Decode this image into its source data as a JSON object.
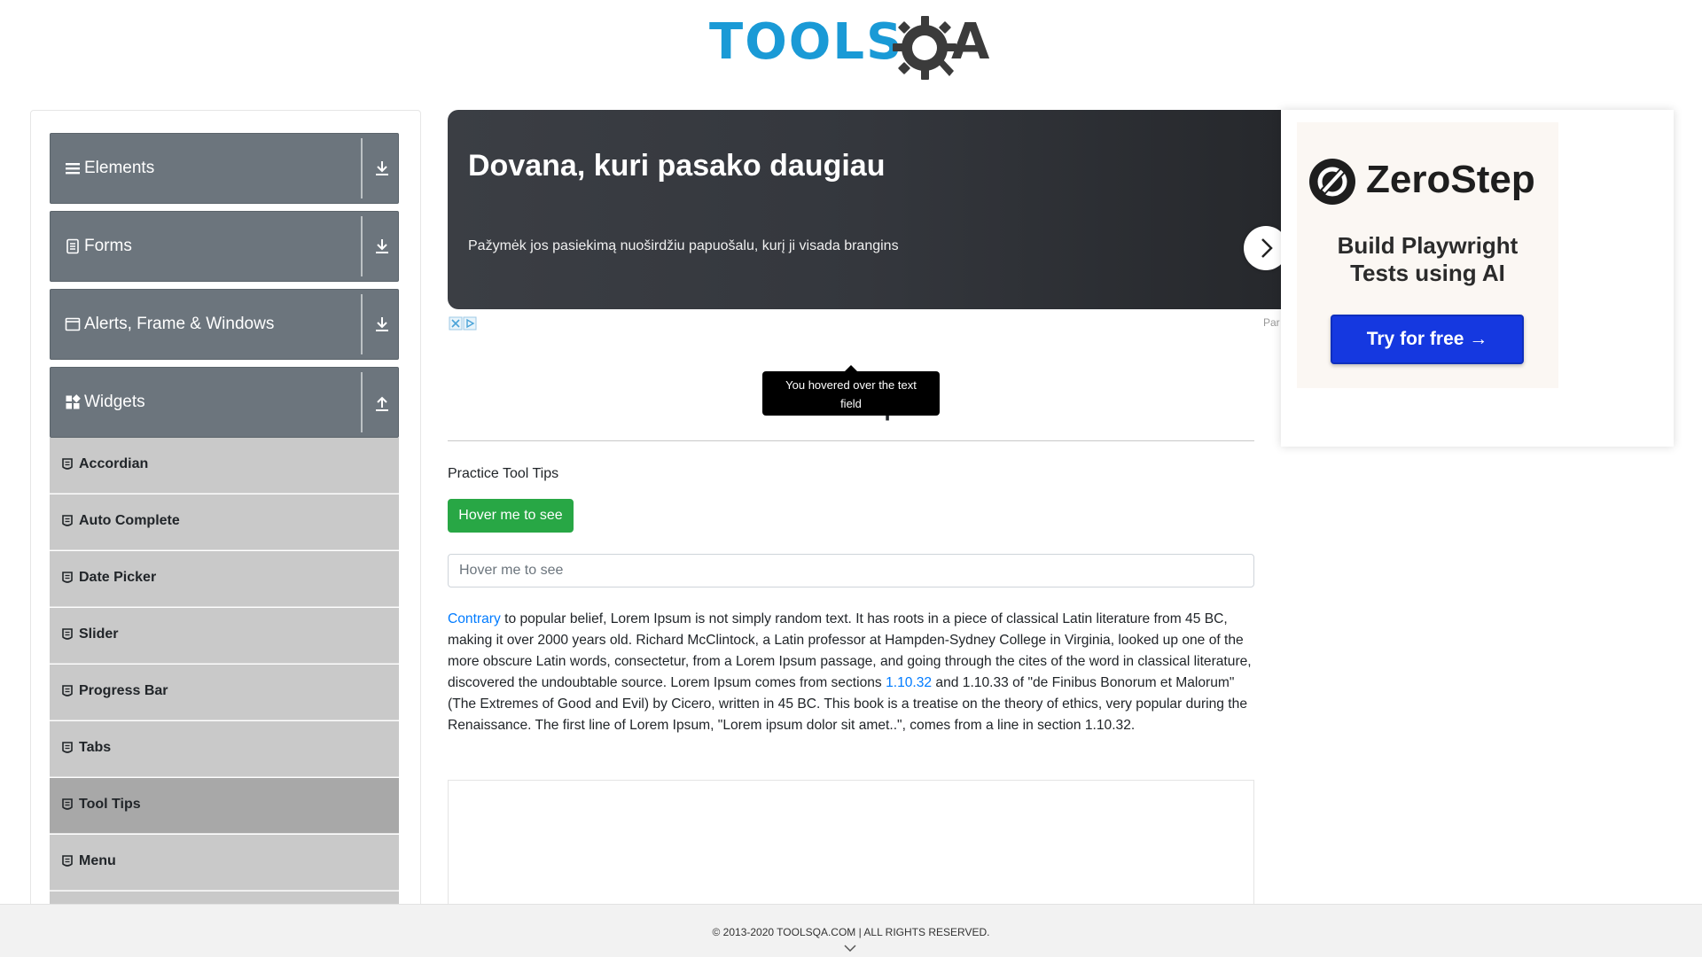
{
  "header": {
    "logo_left": "TOOLS",
    "logo_right": "A",
    "logo_colors": {
      "tools": "#1a9ad6",
      "qa": "#3b3b3b"
    }
  },
  "sidebar": {
    "groups": [
      {
        "label": "Elements",
        "icon": "hamburger-icon",
        "toggle": "download-arrow-icon"
      },
      {
        "label": "Forms",
        "icon": "document-icon",
        "toggle": "download-arrow-icon"
      },
      {
        "label": "Alerts, Frame & Windows",
        "icon": "window-icon",
        "toggle": "download-arrow-icon"
      },
      {
        "label": "Widgets",
        "icon": "widgets-icon",
        "toggle": "upload-arrow-icon"
      }
    ],
    "items": [
      {
        "label": "Accordian",
        "active": false
      },
      {
        "label": "Auto Complete",
        "active": false
      },
      {
        "label": "Date Picker",
        "active": false
      },
      {
        "label": "Slider",
        "active": false
      },
      {
        "label": "Progress Bar",
        "active": false
      },
      {
        "label": "Tabs",
        "active": false
      },
      {
        "label": "Tool Tips",
        "active": true
      },
      {
        "label": "Menu",
        "active": false
      }
    ],
    "group_color": "#6c757d",
    "item_color": "#c9c9c9",
    "active_item_color": "#a8a8a8"
  },
  "ad": {
    "title": "Dovana, kuri pasako daugiau",
    "subtitle": "Pažymėk jos pasiekimą nuoširdžiu papuošalu, kurį ji visada brangins",
    "corner_text": "Par"
  },
  "zerostep": {
    "name": "ZeroStep",
    "tagline_line1": "Build Playwright",
    "tagline_line2": "Tests using AI",
    "button": "Try for free →",
    "button_color": "#1538e0"
  },
  "main": {
    "page_title": "Tool Tips",
    "tooltip_line1": "You hovered over the text",
    "tooltip_line2": "field",
    "practice_label": "Practice Tool Tips",
    "hover_button": "Hover me to see",
    "hover_field_placeholder": "Hover me to see",
    "para_link1": "Contrary",
    "para_part1": " to popular belief, Lorem Ipsum is not simply random text. It has roots in a piece of classical Latin literature from 45 BC, making it over 2000 years old. Richard McClintock, a Latin professor at Hampden-Sydney College in Virginia, looked up one of the more obscure Latin words, consectetur, from a Lorem Ipsum passage, and going through the cites of the word in classical literature, discovered the undoubtable source. Lorem Ipsum comes from sections ",
    "para_link2": "1.10.32",
    "para_part2": " and 1.10.33 of \"de Finibus Bonorum et Malorum\" (The Extremes of Good and Evil) by Cicero, written in 45 BC. This book is a treatise on the theory of ethics, very popular during the Renaissance. The first line of Lorem Ipsum, \"Lorem ipsum dolor sit amet..\", comes from a line in section 1.10.32.",
    "link_color": "#007bff",
    "button_color": "#28a745"
  },
  "footer": {
    "text": "© 2013-2020 TOOLSQA.COM | ALL RIGHTS RESERVED."
  }
}
